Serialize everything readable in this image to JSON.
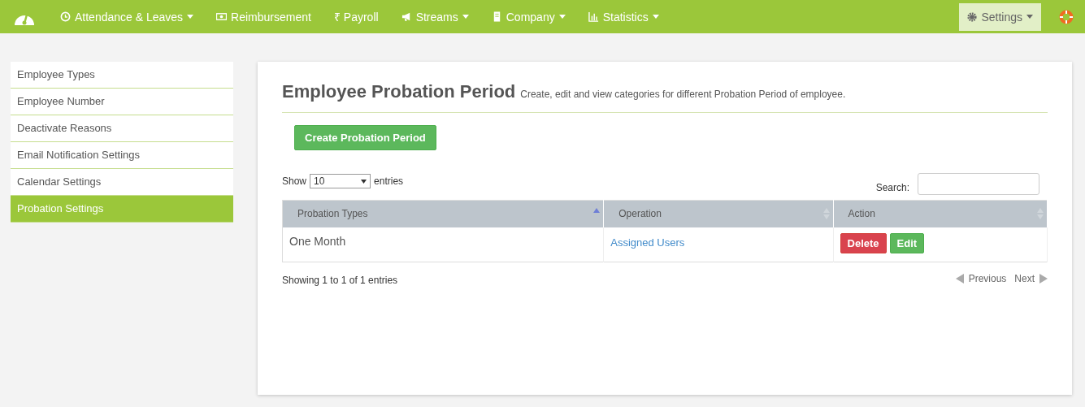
{
  "nav": {
    "items": [
      {
        "label": "Attendance & Leaves",
        "dropdown": true
      },
      {
        "label": "Reimbursement",
        "dropdown": false
      },
      {
        "label": "₹ Payroll",
        "dropdown": false
      },
      {
        "label": "Streams",
        "dropdown": true
      },
      {
        "label": "Company",
        "dropdown": true
      },
      {
        "label": "Statistics",
        "dropdown": true
      }
    ],
    "settings": {
      "label": "Settings",
      "selected": true
    }
  },
  "sidebar": {
    "items": [
      {
        "label": "Employee Types",
        "selected": false
      },
      {
        "label": "Employee Number",
        "selected": false
      },
      {
        "label": "Deactivate Reasons",
        "selected": false
      },
      {
        "label": "Email Notification Settings",
        "selected": false
      },
      {
        "label": "Calendar Settings",
        "selected": false
      },
      {
        "label": "Probation Settings",
        "selected": true
      }
    ]
  },
  "content": {
    "title": "Employee Probation Period",
    "subtitle": "Create, edit and view categories for different Probation Period of employee.",
    "create_button": "Create Probation Period",
    "length": {
      "show": "Show",
      "value": "10",
      "entries": "entries"
    },
    "search": {
      "label": "Search:"
    },
    "table": {
      "columns": [
        {
          "label": "Probation Types",
          "sorted": true
        },
        {
          "label": "Operation",
          "sorted": false
        },
        {
          "label": "Action",
          "sorted": false
        }
      ],
      "rows": [
        {
          "type": "One Month",
          "operation": "Assigned Users",
          "actions": [
            "Delete",
            "Edit"
          ]
        }
      ]
    },
    "info": "Showing 1 to 1 of 1 entries",
    "pager": {
      "previous": "Previous",
      "next": "Next"
    }
  }
}
